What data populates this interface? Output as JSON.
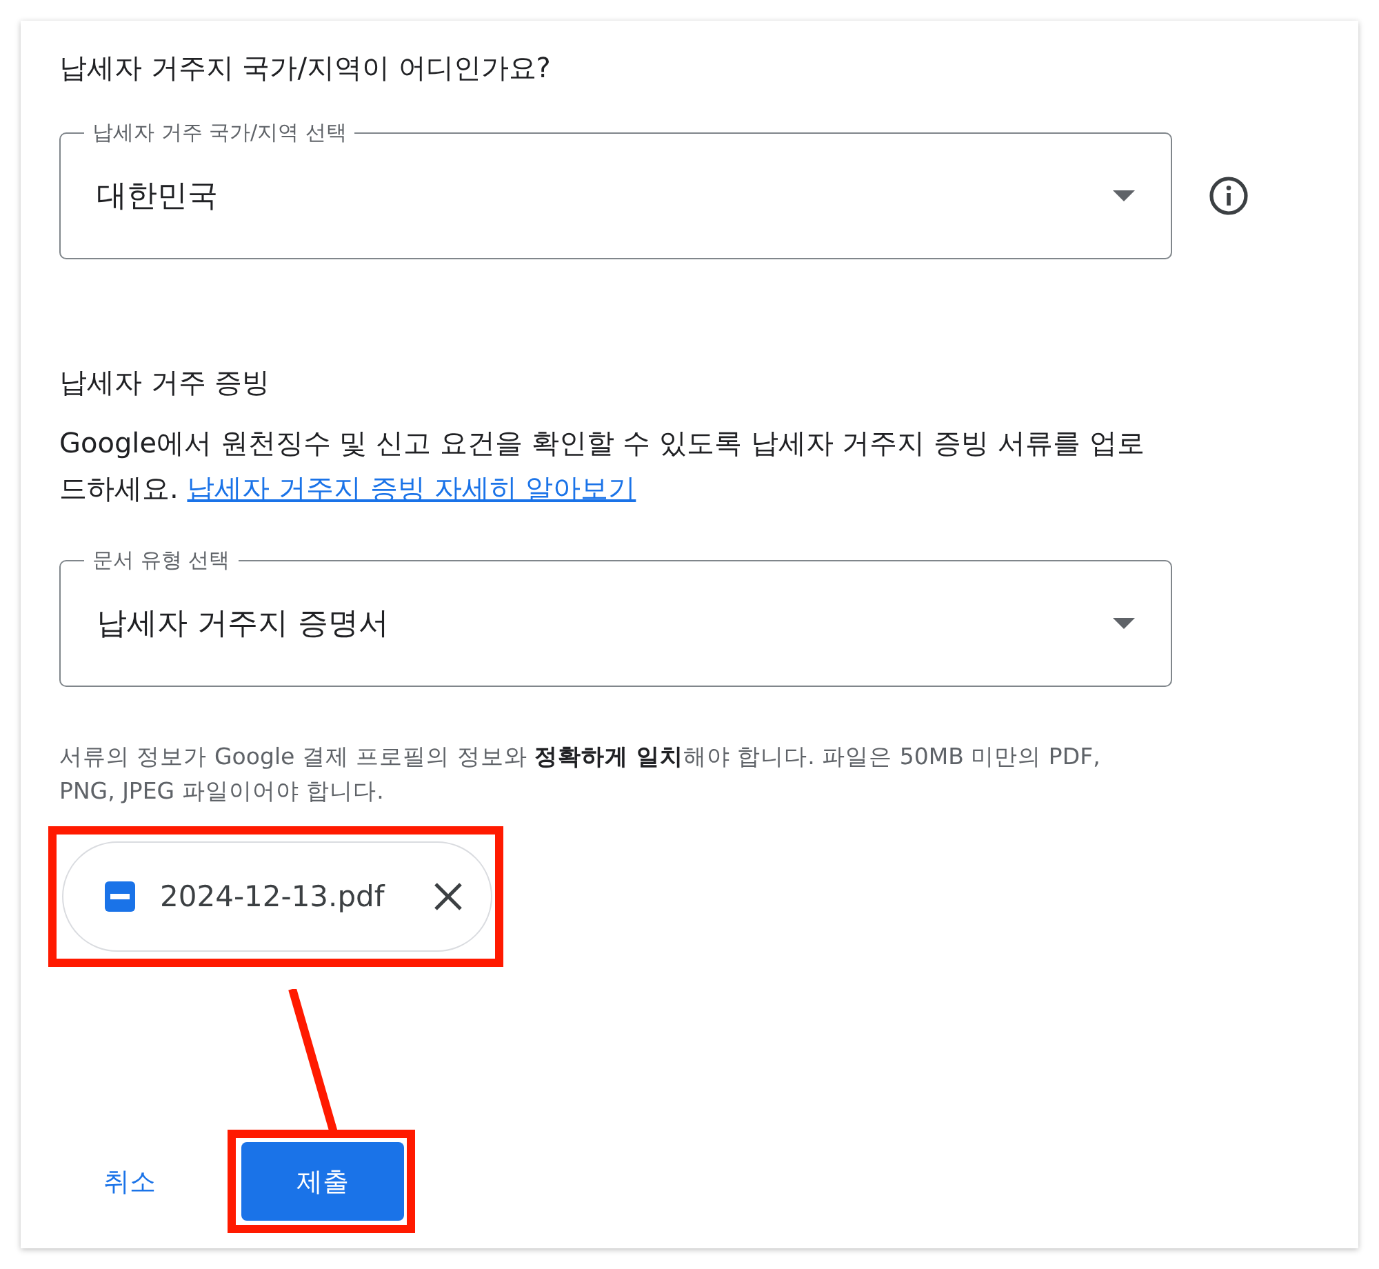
{
  "question": "납세자 거주지 국가/지역이 어디인가요?",
  "country_select": {
    "label": "납세자 거주 국가/지역 선택",
    "value": "대한민국"
  },
  "proof_section": {
    "heading": "납세자 거주 증빙",
    "description": "Google에서 원천징수 및 신고 요건을 확인할 수 있도록 납세자 거주지 증빙 서류를 업로드하세요.",
    "link": "납세자 거주지 증빙 자세히 알아보기"
  },
  "document_select": {
    "label": "문서 유형 선택",
    "value": "납세자 거주지 증명서"
  },
  "help_text": "서류의 정보가 Google 결제 프로필의 정보와 **정확하게 일치**해야 합니다. 파일은 50MB 미만의 PDF, PNG, JPEG 파일이어야 합니다.",
  "file_chip": {
    "name": "2024-12-13.pdf"
  },
  "buttons": [
    {
      "kind": "text",
      "label": "취소"
    },
    {
      "kind": "primary",
      "label": "제출"
    }
  ]
}
